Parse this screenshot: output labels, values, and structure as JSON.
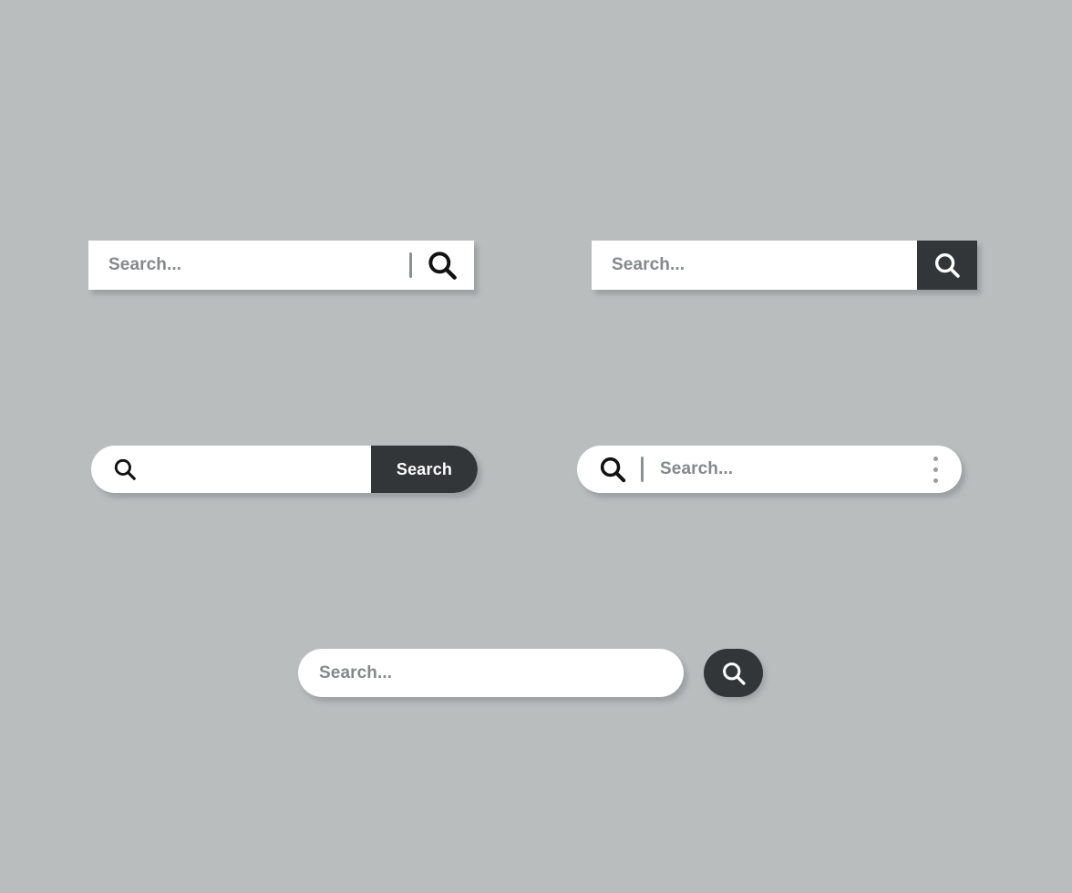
{
  "page": {
    "background_color": "#b9bdbe",
    "accent_dark": "#333638",
    "field_background": "#ffffff",
    "placeholder_color": "#85888a",
    "icon_dark_color": "#111111",
    "icon_light_color": "#ffffff",
    "divider_color": "#8d9092"
  },
  "components": [
    {
      "id": "bar-square-inline",
      "name": "square-search-bar-inline-icon",
      "placeholder": "Search...",
      "value": "",
      "icons": [
        "divider",
        "search-icon"
      ],
      "shape": "square"
    },
    {
      "id": "bar-square-button",
      "name": "square-search-bar-with-button",
      "placeholder": "Search...",
      "value": "",
      "icons": [
        "search-icon"
      ],
      "shape": "square",
      "button_color": "#333638"
    },
    {
      "id": "bar-pill-text",
      "name": "pill-search-bar-with-text-button",
      "placeholder": "",
      "value": "",
      "button_label": "Search",
      "icons": [
        "search-icon"
      ],
      "shape": "pill",
      "button_color": "#333638"
    },
    {
      "id": "bar-pill-menu",
      "name": "pill-search-bar-with-menu",
      "placeholder": "Search...",
      "value": "",
      "icons": [
        "search-icon",
        "divider",
        "kebab-menu-icon"
      ],
      "shape": "pill"
    },
    {
      "id": "bar-pill-plain",
      "name": "pill-search-bar-plain",
      "placeholder": "Search...",
      "value": "",
      "shape": "pill"
    },
    {
      "id": "round-search-button",
      "name": "round-search-button",
      "icons": [
        "search-icon"
      ],
      "shape": "round",
      "button_color": "#333638"
    }
  ],
  "labels": {
    "search_placeholder": "Search...",
    "search_button": "Search"
  }
}
